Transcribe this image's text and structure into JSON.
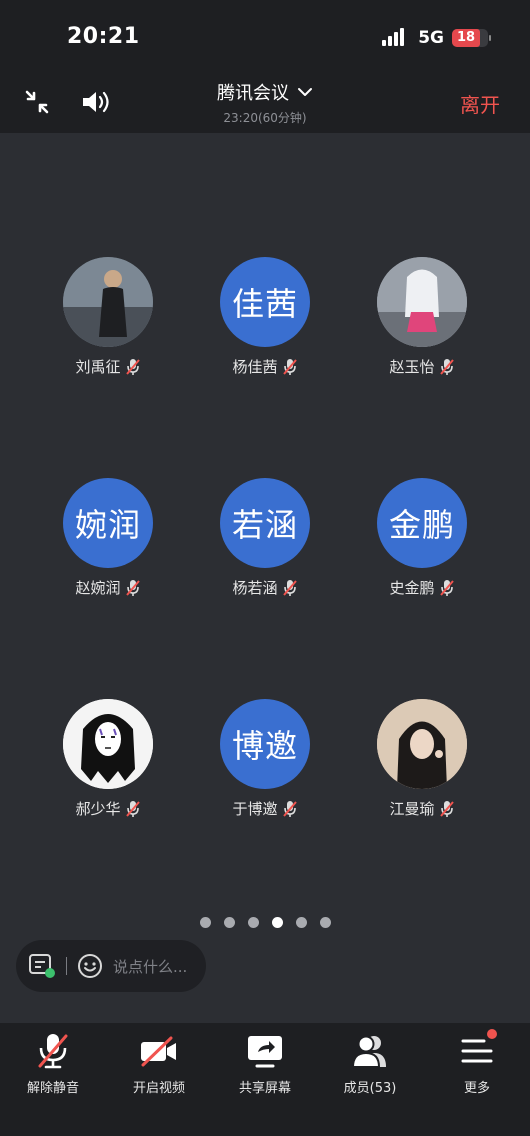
{
  "status": {
    "time": "20:21",
    "network": "5G",
    "battery": "18"
  },
  "header": {
    "title": "腾讯会议",
    "subtitle": "23:20(60分钟)",
    "leave_label": "离开"
  },
  "participants": [
    {
      "name": "刘禹征",
      "avatar_text": "",
      "avatar_type": "photo"
    },
    {
      "name": "杨佳茜",
      "avatar_text": "佳茜",
      "avatar_type": "text"
    },
    {
      "name": "赵玉怡",
      "avatar_text": "",
      "avatar_type": "photo"
    },
    {
      "name": "赵婉润",
      "avatar_text": "婉润",
      "avatar_type": "text"
    },
    {
      "name": "杨若涵",
      "avatar_text": "若涵",
      "avatar_type": "text"
    },
    {
      "name": "史金鹏",
      "avatar_text": "金鹏",
      "avatar_type": "text"
    },
    {
      "name": "郝少华",
      "avatar_text": "",
      "avatar_type": "photo"
    },
    {
      "name": "于博邀",
      "avatar_text": "博邀",
      "avatar_type": "text"
    },
    {
      "name": "江曼瑜",
      "avatar_text": "",
      "avatar_type": "photo"
    }
  ],
  "pagination": {
    "total": 6,
    "active_index": 3
  },
  "chat": {
    "placeholder": "说点什么..."
  },
  "toolbar": {
    "unmute_label": "解除静音",
    "video_label": "开启视频",
    "share_label": "共享屏幕",
    "members_label": "成员(53)",
    "more_label": "更多"
  },
  "colors": {
    "accent": "#3a6fd0",
    "leave": "#f0544f",
    "background": "#2c2e33"
  }
}
